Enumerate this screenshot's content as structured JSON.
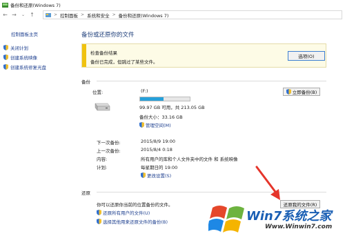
{
  "window": {
    "title": "备份和还原(Windows 7)"
  },
  "address": {
    "crumbs": [
      "控制面板",
      "系统和安全",
      "备份和还原(Windows 7)"
    ],
    "sep": ">"
  },
  "sidebar": {
    "home": "控制面板主页",
    "items": [
      {
        "label": "关闭计划",
        "icon": "shield-icon"
      },
      {
        "label": "创建系统映像",
        "icon": "shield-icon"
      },
      {
        "label": "创建系统修复光盘",
        "icon": "shield-icon"
      }
    ]
  },
  "main": {
    "title": "备份或还原你的文件",
    "check": {
      "title": "检查备份结果",
      "text": "备份已完成，但跳过了某些文件。",
      "button": "选项(O)"
    },
    "backup": {
      "header": "备份",
      "location_label": "位置:",
      "location_value": "(F:)",
      "usage_fraction": 0.47,
      "free_text": "99.97 GB 可用，共 213.05 GB",
      "size_text": "备份大小：33.16 GB",
      "manage_space": "管理空间(M)",
      "backup_now": "立即备份(B)",
      "next_label": "下一次备份:",
      "next_value": "2015/8/9 19:00",
      "last_label": "上一次备份:",
      "last_value": "2015/8/4 0:18",
      "contents_label": "内容:",
      "contents_value": "所有用户的库和个人文件夹中的文件 和 系统映像",
      "schedule_label": "计划:",
      "schedule_value": "每星期日的 19:00",
      "change_settings": "更改设置(S)"
    },
    "restore": {
      "header": "还原",
      "text": "你可以还原你当前的位置备份的文件。",
      "restore_button": "还原我的文件(R)",
      "restore_all": "还原所有用户的文件(U)",
      "select_other": "选择其他用来还原文件的备份(B)"
    }
  },
  "watermark": {
    "brand": "Win7系统之家",
    "url": "Www.Winwin7.com"
  },
  "colors": {
    "accent": "#26a0da",
    "link": "#1d3f8f",
    "warn_stripe": "#f0c20e",
    "arrow": "#e5352b"
  }
}
